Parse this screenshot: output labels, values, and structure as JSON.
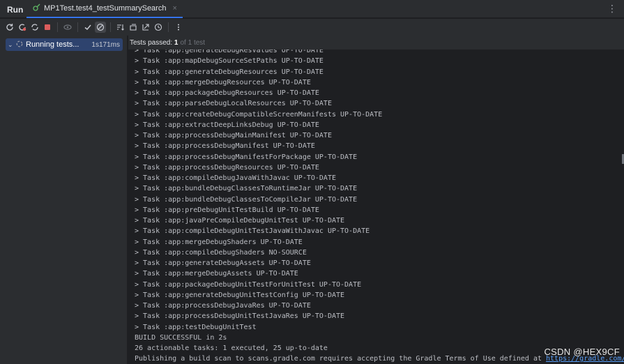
{
  "header": {
    "run_label": "Run",
    "tab_title": "MP1Test.test4_testSummarySearch",
    "close_glyph": "×",
    "more_glyph": "⋮"
  },
  "toolbar": {
    "icons": [
      "rerun-icon",
      "rerun-failed-icon",
      "rerun-automatically-icon",
      "stop-icon",
      "eye-icon",
      "show-passed-icon",
      "show-ignored-icon",
      "sort-icon",
      "collapse-icon",
      "export-icon",
      "history-icon",
      "more-icon"
    ]
  },
  "tree": {
    "chevron": "⌄",
    "label": "Running tests...",
    "duration": "1s171ms"
  },
  "status": {
    "prefix": "Tests passed: ",
    "count": "1",
    "suffix": "of 1 test"
  },
  "console": {
    "lines": [
      "> Task :app:generateDebugResValues UP-TO-DATE",
      "> Task :app:mapDebugSourceSetPaths UP-TO-DATE",
      "> Task :app:generateDebugResources UP-TO-DATE",
      "> Task :app:mergeDebugResources UP-TO-DATE",
      "> Task :app:packageDebugResources UP-TO-DATE",
      "> Task :app:parseDebugLocalResources UP-TO-DATE",
      "> Task :app:createDebugCompatibleScreenManifests UP-TO-DATE",
      "> Task :app:extractDeepLinksDebug UP-TO-DATE",
      "> Task :app:processDebugMainManifest UP-TO-DATE",
      "> Task :app:processDebugManifest UP-TO-DATE",
      "> Task :app:processDebugManifestForPackage UP-TO-DATE",
      "> Task :app:processDebugResources UP-TO-DATE",
      "> Task :app:compileDebugJavaWithJavac UP-TO-DATE",
      "> Task :app:bundleDebugClassesToRuntimeJar UP-TO-DATE",
      "> Task :app:bundleDebugClassesToCompileJar UP-TO-DATE",
      "> Task :app:preDebugUnitTestBuild UP-TO-DATE",
      "> Task :app:javaPreCompileDebugUnitTest UP-TO-DATE",
      "> Task :app:compileDebugUnitTestJavaWithJavac UP-TO-DATE",
      "> Task :app:mergeDebugShaders UP-TO-DATE",
      "> Task :app:compileDebugShaders NO-SOURCE",
      "> Task :app:generateDebugAssets UP-TO-DATE",
      "> Task :app:mergeDebugAssets UP-TO-DATE",
      "> Task :app:packageDebugUnitTestForUnitTest UP-TO-DATE",
      "> Task :app:generateDebugUnitTestConfig UP-TO-DATE",
      "> Task :app:processDebugJavaRes UP-TO-DATE",
      "> Task :app:processDebugUnitTestJavaRes UP-TO-DATE",
      "> Task :app:testDebugUnitTest",
      "BUILD SUCCESSFUL in 2s",
      "26 actionable tasks: 1 executed, 25 up-to-date"
    ],
    "last_line_text": "Publishing a build scan to scans.gradle.com requires accepting the Gradle Terms of Use defined at ",
    "last_line_link": "https://gradle.com/help/legal-"
  },
  "watermark": "CSDN @HEX9CF",
  "colors": {
    "accent": "#3574f0",
    "selection": "#2e436e",
    "link": "#589df6",
    "stop": "#db5c5c",
    "pass": "#5fb865"
  }
}
